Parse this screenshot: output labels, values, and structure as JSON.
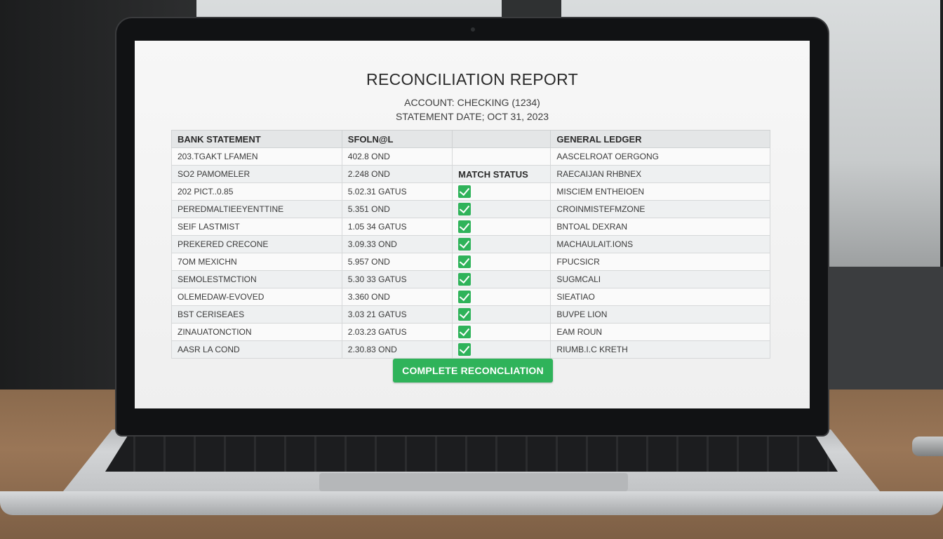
{
  "report": {
    "title": "RECONCILIATION REPORT",
    "account": "ACCOUNT: CHECKING (1234)",
    "statement_date": "STATEMENT DATE; OCT 31, 2023"
  },
  "table": {
    "headers": [
      "BANK STATEMENT",
      "SFOLN@L",
      "",
      "GENERAL LEDGER"
    ],
    "match_status_label": "MATCH STATUS",
    "rows": [
      {
        "bank": "203.TGAKT LFAMEN",
        "amount": "402.8 OND",
        "matched": false,
        "ledger": "AASCELROAT OERGONG"
      },
      {
        "bank": "SO2 PAMOMELER",
        "amount": "2.248 OND",
        "matched": false,
        "ledger": "RAECAIJAN RHBNEX"
      },
      {
        "bank": "202 PICT..0.85",
        "amount": "5.02.31 GATUS",
        "matched": true,
        "ledger": "MISCIEM ENTHEIOEN"
      },
      {
        "bank": "PEREDMALTIEEYENTTINE",
        "amount": "5.351 OND",
        "matched": true,
        "ledger": "CROINMISTEFMZONE"
      },
      {
        "bank": "SEIF LASTMIST",
        "amount": "1.05 34 GATUS",
        "matched": true,
        "ledger": "BNTOAL DEXRAN"
      },
      {
        "bank": "PREKERED CRECONE",
        "amount": "3.09.33 OND",
        "matched": true,
        "ledger": "MACHAULAIT.IONS"
      },
      {
        "bank": "7OM MEXICHN",
        "amount": "5.957 OND",
        "matched": true,
        "ledger": "FPUCSICR"
      },
      {
        "bank": "SEMOLESTMCTION",
        "amount": "5.30 33 GATUS",
        "matched": true,
        "ledger": "SUGMCALI"
      },
      {
        "bank": "OLEMEDAW-EVOVED",
        "amount": "3.360 OND",
        "matched": true,
        "ledger": "SIEATIAO"
      },
      {
        "bank": "BST CERISEAES",
        "amount": "3.03 21 GATUS",
        "matched": true,
        "ledger": "BUVPE LION"
      },
      {
        "bank": "ZINAUATONCTION",
        "amount": "2.03.23 GATUS",
        "matched": true,
        "ledger": "EAM ROUN"
      },
      {
        "bank": "AASR LA COND",
        "amount": "2.30.83 OND",
        "matched": true,
        "ledger": "RIUMB.I.C KRETH"
      }
    ]
  },
  "actions": {
    "complete_label": "COMPLETE RECONCLIATION"
  },
  "colors": {
    "accent_green": "#2fb35a",
    "screen_bg": "#f7f7f7",
    "header_bg": "#e4e6e7"
  }
}
